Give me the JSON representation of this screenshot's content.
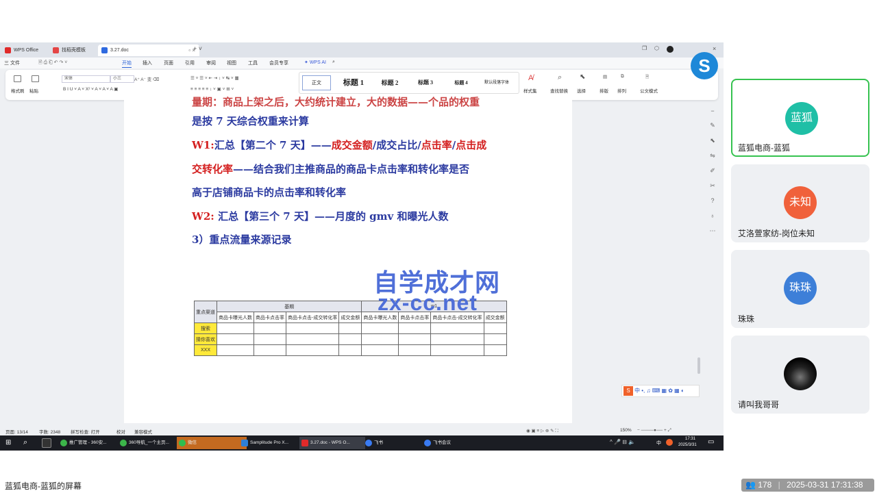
{
  "tabs": {
    "wps_home": "WPS Office",
    "template": "找稻壳模板",
    "doc": "3.27.doc"
  },
  "menu": {
    "file": "三 文件",
    "items": [
      "开始",
      "插入",
      "页面",
      "引用",
      "审阅",
      "视图",
      "工具",
      "会员专享"
    ],
    "wps_ai": "WPS AI"
  },
  "ribbon": {
    "format_painter": "格式刷",
    "paste": "粘贴",
    "font_name": "宋体",
    "font_size": "小三",
    "styles": [
      "正文",
      "标题 1",
      "标题 2",
      "标题 3",
      "标题 4",
      "默认段落字体"
    ],
    "style_set": "样式集",
    "find_replace": "查找替换",
    "select": "选择",
    "typeset": "排版",
    "arrange": "排列",
    "official_mode": "公文模式"
  },
  "document": {
    "line0": "量期：商品上架之后，大约统计建立，大的数据——个品的权重",
    "line1": "是按 7 天综合权重来计算",
    "w1_label": "W1:",
    "w1_text": "汇总【第二个 7 天】——",
    "w1_r1": "成交金额",
    "w1_t2": "/成交占比/",
    "w1_r2": "点击率",
    "w1_t3": "/",
    "w1_r3": "点击成",
    "line3_red": "交转化率",
    "line3_text": "——结合我们主推商品的商品卡点击率和转化率是否",
    "line4": "高于店铺商品卡的点击率和转化率",
    "w2_label": "W2:",
    "w2_text": "汇总【第三个 7 天】——月度的 gmv 和曝光人数",
    "section3": "3）重点流量来源记录",
    "table": {
      "corner": "重点渠道",
      "group1": "基期",
      "group2": "w1",
      "subheads": [
        "商品卡曝光人数",
        "商品卡点击率",
        "商品卡点击-成交转化率",
        "成交金额",
        "商品卡曝光人数",
        "商品卡点击率",
        "商品卡点击-成交转化率",
        "成交金额"
      ],
      "rows": [
        "搜索",
        "猜你喜欢",
        "XXX"
      ]
    }
  },
  "watermark": {
    "cn": "自学成才网",
    "url": "zx-cc.net"
  },
  "statusbar": {
    "page": "页面: 13/14",
    "words": "字数: 2348",
    "spell": "拼写检查: 打开",
    "proof": "校对",
    "compat": "兼容模式",
    "zoom": "150%"
  },
  "taskbar": {
    "apps": [
      "推广管理 - 360安...",
      "360导航_一个主页...",
      "微信",
      "Samplitude Pro X...",
      "3.27.doc - WPS O...",
      "飞书",
      "飞书会议"
    ],
    "ime": "中",
    "time": "17:31",
    "date": "2025/3/31"
  },
  "participants": [
    {
      "avatar": "蓝狐",
      "name": "蓝狐电商-蓝狐",
      "color": "#1fbfa6"
    },
    {
      "avatar": "未知",
      "name": "艾洛萱家纺-岗位未知",
      "color": "#f0613b"
    },
    {
      "avatar": "珠珠",
      "name": "珠珠",
      "color": "#3d7fd8"
    },
    {
      "avatar": "",
      "name": "请叫我哥哥",
      "color": "#111111"
    }
  ],
  "caption": "蓝狐电商-蓝狐的屏幕",
  "viewer_count": "178",
  "timestamp": "2025-03-31 17:31:38"
}
